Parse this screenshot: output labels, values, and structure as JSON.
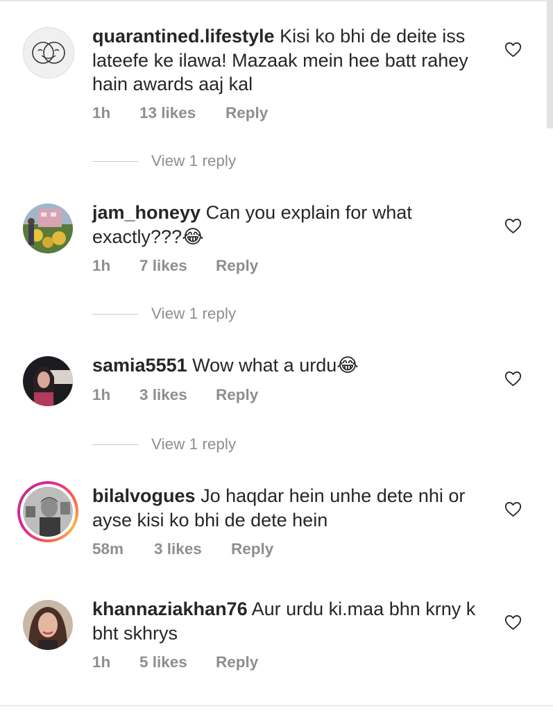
{
  "comments": [
    {
      "username": "quarantined.lifestyle",
      "text": "Kisi ko bhi de deite iss lateefe ke ilawa! Mazaak mein hee batt rahey hain awards aaj kal",
      "time": "1h",
      "likes": "13 likes",
      "reply_label": "Reply",
      "view_replies": "View 1 reply",
      "avatar_icon": "laughing-cry-face-line-logo"
    },
    {
      "username": "jam_honeyy",
      "text": "Can you explain for what exactly???😂",
      "time": "1h",
      "likes": "7 likes",
      "reply_label": "Reply",
      "view_replies": "View 1 reply",
      "avatar_icon": "photo-woman-with-flowers"
    },
    {
      "username": "samia5551",
      "text": "Wow what a urdu😂",
      "time": "1h",
      "likes": "3 likes",
      "reply_label": "Reply",
      "view_replies": "View 1 reply",
      "avatar_icon": "photo-woman-portrait"
    },
    {
      "username": "bilalvogues",
      "text": "Jo haqdar hein unhe dete nhi or ayse kisi ko bhi de dete hein",
      "time": "58m",
      "likes": "3 likes",
      "reply_label": "Reply",
      "avatar_icon": "photo-man-grayscale-story-ring"
    },
    {
      "username": "khannaziakhan76",
      "text": "Aur urdu ki.maa bhn krny k bht skhrys",
      "time": "1h",
      "likes": "5 likes",
      "reply_label": "Reply",
      "avatar_icon": "photo-woman-selfie"
    }
  ],
  "colors": {
    "text": "#262626",
    "secondary": "#8e8e8e",
    "story_ring": [
      "#d6249f",
      "#fd5949",
      "#fdb347"
    ]
  },
  "icons": {
    "like": "heart-outline-icon"
  }
}
